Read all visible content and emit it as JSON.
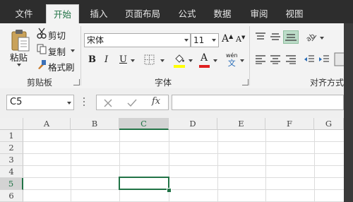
{
  "tabs": [
    {
      "label": "文件"
    },
    {
      "label": "开始"
    },
    {
      "label": "插入"
    },
    {
      "label": "页面布局"
    },
    {
      "label": "公式"
    },
    {
      "label": "数据"
    },
    {
      "label": "审阅"
    },
    {
      "label": "视图"
    }
  ],
  "active_tab": "开始",
  "clipboard": {
    "paste_label": "粘贴",
    "cut_label": "剪切",
    "copy_label": "复制",
    "format_painter_label": "格式刷",
    "group_label": "剪贴板"
  },
  "font": {
    "font_name": "宋体",
    "font_size": "11",
    "bold_label": "B",
    "italic_label": "I",
    "underline_label": "U",
    "highlight_label": "A",
    "font_color_label": "A",
    "grow_label": "A",
    "shrink_label": "A",
    "phonetic_top": "wén",
    "phonetic_bottom": "文",
    "group_label": "字体",
    "highlight_color": "#ffff00",
    "font_color": "#e02020"
  },
  "alignment": {
    "group_label": "对齐方式"
  },
  "formula_bar": {
    "name_box": "C5",
    "fx_label": "fx",
    "formula_value": ""
  },
  "grid": {
    "columns": [
      "A",
      "B",
      "C",
      "D",
      "E",
      "F",
      "G"
    ],
    "rows": [
      "1",
      "2",
      "3",
      "4",
      "5",
      "6"
    ],
    "selected_cell": "C5",
    "accent_color": "#217346"
  }
}
